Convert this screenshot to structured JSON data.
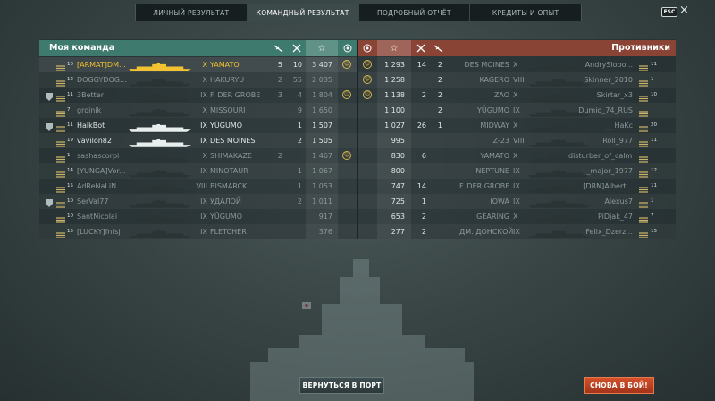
{
  "tabs": [
    {
      "label": "ЛИЧНЫЙ РЕЗУЛЬТАТ"
    },
    {
      "label": "КОМАНДНЫЙ РЕЗУЛЬТАТ",
      "active": true
    },
    {
      "label": "ПОДРОБНЫЙ ОТЧЁТ"
    },
    {
      "label": "КРЕДИТЫ И ОПЫТ"
    }
  ],
  "esc_label": "ESC",
  "close_glyph": "×",
  "my_team": {
    "title": "Моя команда",
    "header_icons": [
      "plane-icon",
      "crossed-swords-icon",
      "star-icon",
      "laurel-icon"
    ],
    "rows": [
      {
        "tier": "10",
        "name": "[ARMAT]DM...",
        "ship_tier": "X",
        "ship": "YAMATO",
        "planes": "5",
        "kills": "10",
        "xp": "3 407",
        "medal": true,
        "self": true,
        "rank": "",
        "ship_class": "battleship"
      },
      {
        "tier": "12",
        "name": "DOGGYDOG...",
        "ship_tier": "X",
        "ship": "HAKURYU",
        "planes": "2",
        "kills": "55",
        "xp": "2 035",
        "medal": false,
        "dead": true,
        "rank": "",
        "ship_class": "carrier"
      },
      {
        "tier": "11",
        "name": "3Better",
        "ship_tier": "IX",
        "ship": "F. DER GROBE",
        "planes": "3",
        "kills": "4",
        "xp": "1 804",
        "medal": true,
        "dead": true,
        "rank": "shield",
        "ship_class": "battleship"
      },
      {
        "tier": "7",
        "name": "groinik",
        "ship_tier": "X",
        "ship": "MISSOURI",
        "planes": "",
        "kills": "9",
        "xp": "1 650",
        "medal": false,
        "dead": true,
        "rank": "",
        "ship_class": "battleship"
      },
      {
        "tier": "11",
        "name": "HalkBot",
        "ship_tier": "IX",
        "ship": "YŪGUMO",
        "planes": "",
        "kills": "1",
        "xp": "1 507",
        "medal": false,
        "rank": "shield",
        "ship_class": "destroyer"
      },
      {
        "tier": "19",
        "name": "vavilon82",
        "ship_tier": "IX",
        "ship": "DES MOINES",
        "planes": "",
        "kills": "2",
        "xp": "1 505",
        "medal": false,
        "rank": "",
        "ship_class": "cruiser"
      },
      {
        "tier": "1",
        "name": "sashascorpi",
        "ship_tier": "X",
        "ship": "SHIMAKAZE",
        "planes": "2",
        "kills": "",
        "xp": "1 467",
        "medal": true,
        "dead": true,
        "rank": "",
        "ship_class": "destroyer"
      },
      {
        "tier": "14",
        "name": "[YUNGA]Vor...",
        "ship_tier": "IX",
        "ship": "MINOTAUR",
        "planes": "",
        "kills": "1",
        "xp": "1 067",
        "medal": false,
        "dead": true,
        "rank": "",
        "ship_class": "cruiser"
      },
      {
        "tier": "15",
        "name": "AdReNaLiN...",
        "ship_tier": "VIII",
        "ship": "BISMARCK",
        "planes": "",
        "kills": "1",
        "xp": "1 053",
        "medal": false,
        "dead": true,
        "rank": "",
        "ship_class": "battleship"
      },
      {
        "tier": "10",
        "name": "SerVal77",
        "ship_tier": "IX",
        "ship": "УДАЛОЙ",
        "planes": "",
        "kills": "2",
        "xp": "1 011",
        "medal": false,
        "dead": true,
        "rank": "shield-star",
        "ship_class": "destroyer"
      },
      {
        "tier": "10",
        "name": "SantNicolai",
        "ship_tier": "IX",
        "ship": "YŪGUMO",
        "planes": "",
        "kills": "",
        "xp": "917",
        "medal": false,
        "dead": true,
        "rank": "",
        "ship_class": "destroyer"
      },
      {
        "tier": "15",
        "name": "[LUCKY]fnfsj",
        "ship_tier": "IX",
        "ship": "FLETCHER",
        "planes": "",
        "kills": "",
        "xp": "376",
        "medal": false,
        "dead": true,
        "rank": "",
        "ship_class": "destroyer"
      }
    ]
  },
  "enemy_team": {
    "title": "Противники",
    "header_icons": [
      "laurel-icon",
      "star-icon",
      "crossed-swords-icon",
      "plane-icon"
    ],
    "rows": [
      {
        "medal": true,
        "xp": "1 293",
        "kills": "14",
        "planes": "2",
        "ship": "DES MOINES",
        "ship_tier": "X",
        "name": "AndrySlobo...",
        "tier": "11",
        "dead": true
      },
      {
        "medal": true,
        "xp": "1 258",
        "kills": "",
        "planes": "2",
        "ship": "KAGERO",
        "ship_tier": "VIII",
        "name": "Skinner_2010",
        "tier": "1",
        "dead": true
      },
      {
        "medal": true,
        "xp": "1 138",
        "kills": "2",
        "planes": "2",
        "ship": "ZAO",
        "ship_tier": "X",
        "name": "Skirtar_x3",
        "tier": "10",
        "dead": true
      },
      {
        "medal": false,
        "xp": "1 100",
        "kills": "",
        "planes": "2",
        "ship": "YŪGUMO",
        "ship_tier": "IX",
        "name": "Dumio_74_RUS",
        "tier": "",
        "dead": true
      },
      {
        "medal": false,
        "xp": "1 027",
        "kills": "26",
        "planes": "1",
        "ship": "MIDWAY",
        "ship_tier": "X",
        "name": "___HaKc",
        "tier": "20",
        "dead": true
      },
      {
        "medal": false,
        "xp": "995",
        "kills": "",
        "planes": "",
        "ship": "Z-23",
        "ship_tier": "VIII",
        "name": "Roll_977",
        "tier": "11",
        "dead": true
      },
      {
        "medal": false,
        "xp": "830",
        "kills": "6",
        "planes": "",
        "ship": "YAMATO",
        "ship_tier": "X",
        "name": "disturber_of_calm...",
        "tier": "",
        "dead": true
      },
      {
        "medal": false,
        "xp": "800",
        "kills": "",
        "planes": "",
        "ship": "NEPTUNE",
        "ship_tier": "IX",
        "name": "_major_1977",
        "tier": "12",
        "dead": true
      },
      {
        "medal": false,
        "xp": "747",
        "kills": "14",
        "planes": "",
        "ship": "F. DER GROBE",
        "ship_tier": "IX",
        "name": "[DRN]Albert...",
        "tier": "11",
        "dead": true
      },
      {
        "medal": false,
        "xp": "725",
        "kills": "1",
        "planes": "",
        "ship": "IOWA",
        "ship_tier": "IX",
        "name": "Alexus7",
        "tier": "1",
        "dead": true
      },
      {
        "medal": false,
        "xp": "653",
        "kills": "2",
        "planes": "",
        "ship": "GEARING",
        "ship_tier": "X",
        "name": "PiDjak_47",
        "tier": "7",
        "dead": true
      },
      {
        "medal": false,
        "xp": "277",
        "kills": "2",
        "planes": "",
        "ship": "ДМ. ДОНСКОЙ",
        "ship_tier": "IX",
        "name": "Felix_Dzerz...",
        "tier": "15",
        "dead": true
      }
    ]
  },
  "buttons": {
    "port": "ВЕРНУТЬСЯ В ПОРТ",
    "battle": "СНОВА В БОЙ!"
  },
  "colors": {
    "ally_header": "#3f7a6e",
    "enemy_header": "#8a4436",
    "highlight": "#f3c230",
    "battle_button": "#c2451f"
  }
}
